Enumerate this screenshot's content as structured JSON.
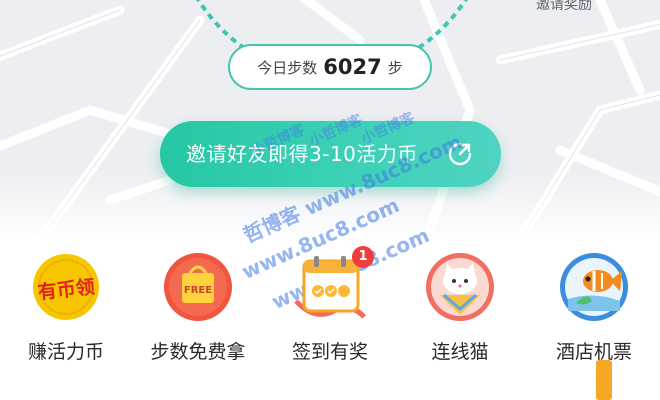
{
  "header": {
    "invite_reward_label": "邀请奖励"
  },
  "steps": {
    "label": "今日步数",
    "count": "6027",
    "unit": "步"
  },
  "invite_button": {
    "label": "邀请好友即得3-10活力币"
  },
  "watermarks": [
    "小哲博客",
    "小哲博客",
    "小哲博客",
    "哲博客 www.8uc8.com",
    "www.8uc8.com",
    "www.8uc8.com"
  ],
  "features": [
    {
      "label": "赚活力币",
      "icon": "earn-coin-icon",
      "icon_text": "有币领"
    },
    {
      "label": "步数免费拿",
      "icon": "free-gift-bag-icon",
      "icon_text": "FREE"
    },
    {
      "label": "签到有奖",
      "icon": "calendar-checkin-icon"
    },
    {
      "label": "连线猫",
      "icon": "cat-icon"
    },
    {
      "label": "酒店机票",
      "icon": "fish-travel-icon"
    }
  ],
  "notification_badge": "1",
  "colors": {
    "accent": "#3cd1b6",
    "badge": "#f03c3c",
    "coin": "#f5c000",
    "gift": "#f1543f"
  }
}
